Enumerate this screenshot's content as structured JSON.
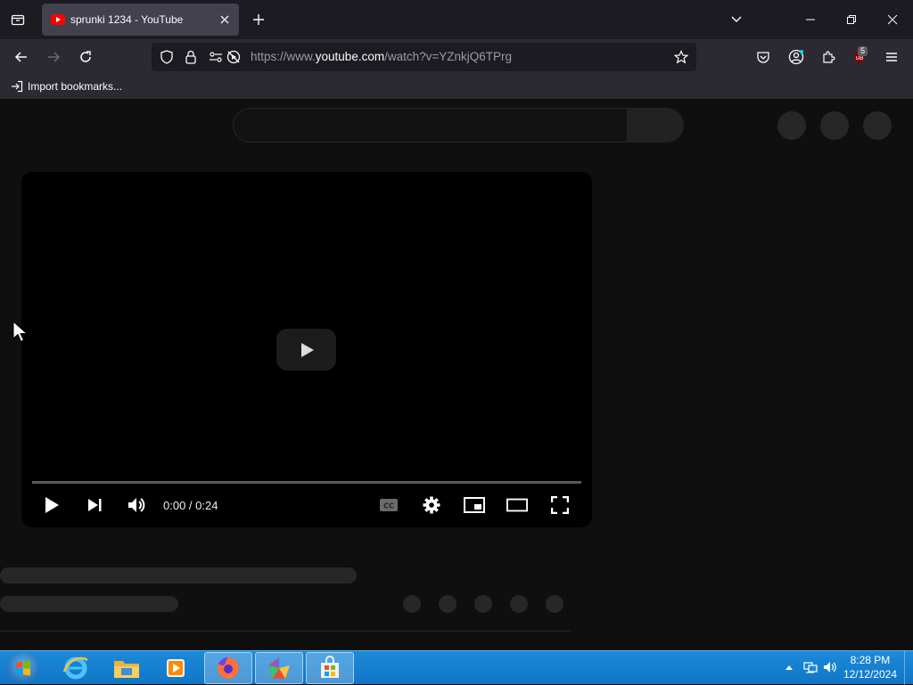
{
  "browser": {
    "tab": {
      "title": "sprunki 1234 - YouTube"
    },
    "url": {
      "prefix": "https://www.",
      "host": "youtube.com",
      "path": "/watch?v=YZnkjQ6TPrg"
    },
    "extensions_badge": "5",
    "bookmarks": {
      "import_label": "Import bookmarks..."
    }
  },
  "player": {
    "time": "0:00 / 0:24",
    "progress_fraction": 0
  },
  "taskbar": {
    "time": "8:28 PM",
    "date": "12/12/2024",
    "apps": [
      "internet-explorer",
      "file-explorer",
      "media-player",
      "firefox",
      "app-launcher",
      "microsoft-store"
    ]
  },
  "colors": {
    "page_bg": "#0f0f0f",
    "skeleton": "#272727",
    "youtube_red": "#ff0000",
    "taskbar_blue": "#1b8bd9"
  }
}
